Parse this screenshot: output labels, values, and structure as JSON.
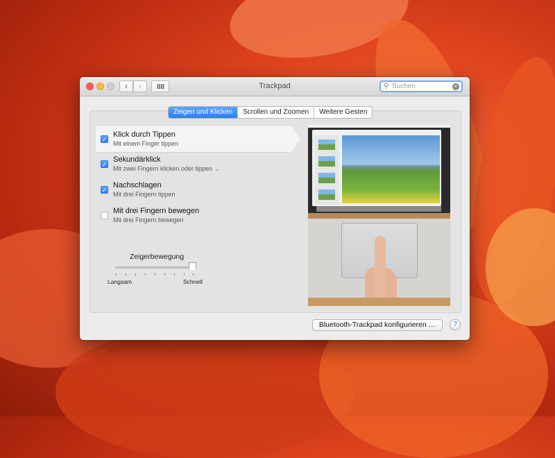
{
  "window": {
    "title": "Trackpad"
  },
  "toolbar": {
    "back_icon": "‹",
    "forward_icon": "›"
  },
  "search": {
    "placeholder": "Suchen",
    "value": ""
  },
  "tabs": [
    {
      "label": "Zeigen und Klicken",
      "active": true
    },
    {
      "label": "Scrollen und Zoomen",
      "active": false
    },
    {
      "label": "Weitere Gesten",
      "active": false
    }
  ],
  "options": [
    {
      "title": "Klick durch Tippen",
      "subtitle": "Mit einem Finger tippen",
      "checked": true
    },
    {
      "title": "Sekundärklick",
      "subtitle": "Mit zwei Fingern klicken oder tippen",
      "checked": true
    },
    {
      "title": "Nachschlagen",
      "subtitle": "Mit drei Fingern tippen",
      "checked": true
    },
    {
      "title": "Mit drei Fingern bewegen",
      "subtitle": "Mit drei Fingern bewegen",
      "checked": false
    }
  ],
  "slider": {
    "label": "Zeigerbewegung",
    "min_label": "Langsam",
    "max_label": "Schnell",
    "value_fraction": 1.0
  },
  "footer": {
    "bluetooth_button": "Bluetooth-Trackpad konfigurieren …",
    "help": "?"
  },
  "colors": {
    "accent": "#2d7ef3",
    "desktop": "#e0441e"
  }
}
